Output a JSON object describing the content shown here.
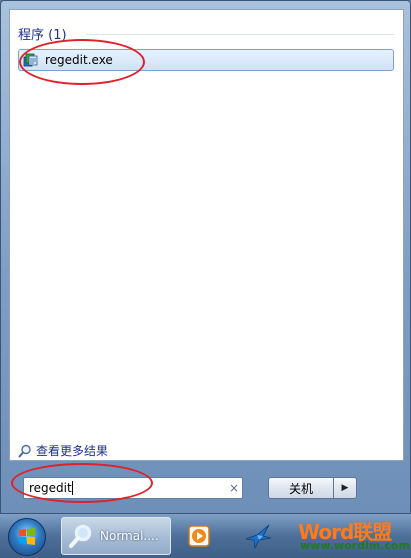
{
  "results": {
    "section_title": "程序 (1)",
    "items": [
      {
        "label": "regedit.exe",
        "icon": "regedit-icon"
      }
    ],
    "see_more_label": "查看更多结果"
  },
  "search": {
    "value": "regedit",
    "clear_glyph": "×"
  },
  "shutdown": {
    "label": "关机",
    "arrow_glyph": "▶"
  },
  "taskbar": {
    "active_label": "Normal....",
    "items": [
      "search-app-icon",
      "media-player-icon",
      "bird-app-icon"
    ]
  },
  "watermark": {
    "title": "Word联盟",
    "url": "www.wordlm.com"
  },
  "colors": {
    "annotation": "#e0202a",
    "link": "#1e3287",
    "selection": "#cfe2f7"
  }
}
